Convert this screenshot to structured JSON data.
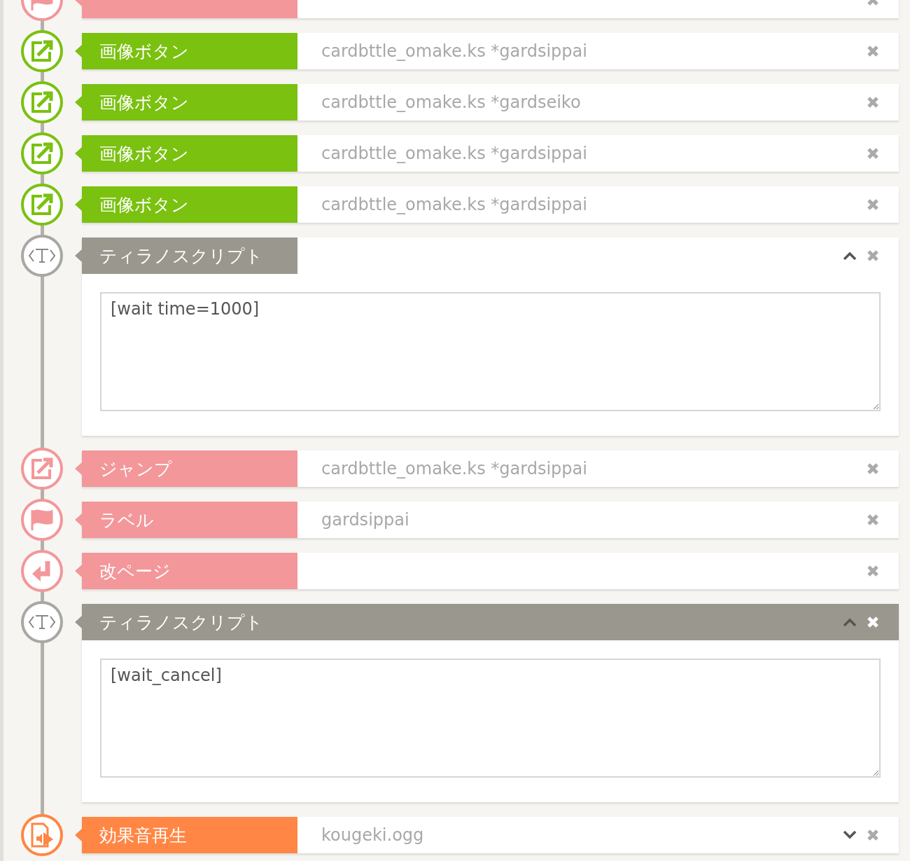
{
  "rows": [
    {
      "kind": "label"
    },
    {
      "kind": "image_button",
      "title": "画像ボタン",
      "value": "cardbttle_omake.ks *gardsippai"
    },
    {
      "kind": "image_button",
      "title": "画像ボタン",
      "value": "cardbttle_omake.ks *gardseiko"
    },
    {
      "kind": "image_button",
      "title": "画像ボタン",
      "value": "cardbttle_omake.ks *gardsippai"
    },
    {
      "kind": "image_button",
      "title": "画像ボタン",
      "value": "cardbttle_omake.ks *gardsippai"
    },
    {
      "kind": "script",
      "title": "ティラノスクリプト",
      "selected": false,
      "expanded": true,
      "code": "[wait time=1000]"
    },
    {
      "kind": "jump",
      "title": "ジャンプ",
      "value": "cardbttle_omake.ks *gardsippai"
    },
    {
      "kind": "label",
      "title": "ラベル",
      "value": "gardsippai"
    },
    {
      "kind": "page_break",
      "title": "改ページ"
    },
    {
      "kind": "script",
      "title": "ティラノスクリプト",
      "selected": true,
      "expanded": true,
      "code": "[wait_cancel]"
    },
    {
      "kind": "sound",
      "title": "効果音再生",
      "value": "kougeki.ogg",
      "expanded": false
    }
  ]
}
